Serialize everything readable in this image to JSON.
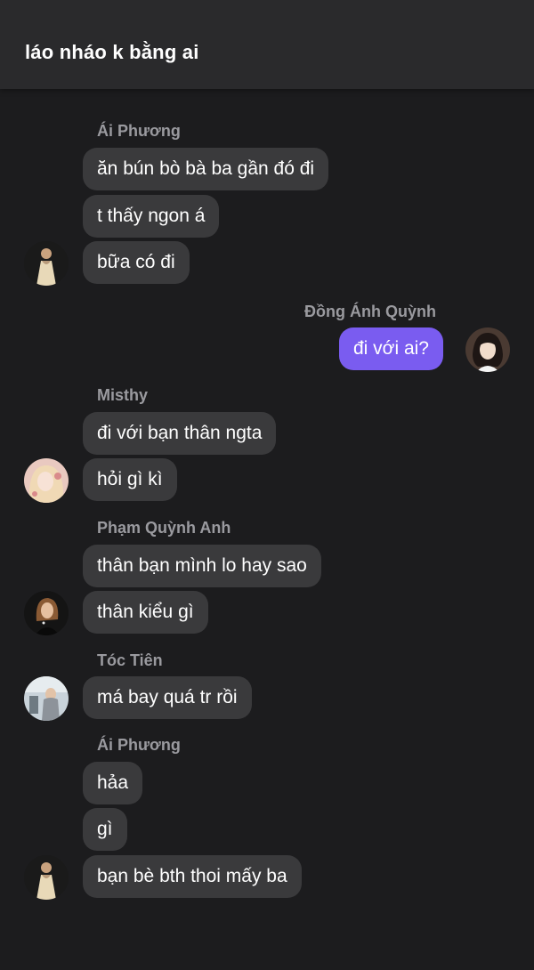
{
  "header": {
    "title": "láo nháo k bằng ai"
  },
  "colors": {
    "background": "#1c1c1e",
    "header": "#2a2a2c",
    "bubble_other": "#3a3a3c",
    "bubble_mine": "#7a5cf0",
    "sender_name": "#9a9a9f"
  },
  "groups": [
    {
      "sender": "Ái Phương",
      "side": "left",
      "avatar_icon": "user-avatar-icon",
      "messages": [
        "ăn bún bò bà ba gần đó đi",
        "t thấy ngon á",
        "bữa có đi"
      ]
    },
    {
      "sender": "Đồng Ánh Quỳnh",
      "side": "right",
      "avatar_icon": "user-avatar-icon",
      "messages": [
        "đi với ai?"
      ]
    },
    {
      "sender": "Misthy",
      "side": "left",
      "avatar_icon": "user-avatar-icon",
      "messages": [
        "đi với bạn thân ngta",
        "hỏi gì kì"
      ]
    },
    {
      "sender": "Phạm Quỳnh Anh",
      "side": "left",
      "avatar_icon": "user-avatar-icon",
      "messages": [
        "thân bạn mình lo hay sao",
        "thân kiểu gì"
      ]
    },
    {
      "sender": "Tóc Tiên",
      "side": "left",
      "avatar_icon": "user-avatar-icon",
      "messages": [
        "má bay quá tr rồi"
      ]
    },
    {
      "sender": "Ái Phương",
      "side": "left",
      "avatar_icon": "user-avatar-icon",
      "messages": [
        "hảa",
        "gì",
        "bạn bè bth thoi mấy ba"
      ]
    }
  ]
}
